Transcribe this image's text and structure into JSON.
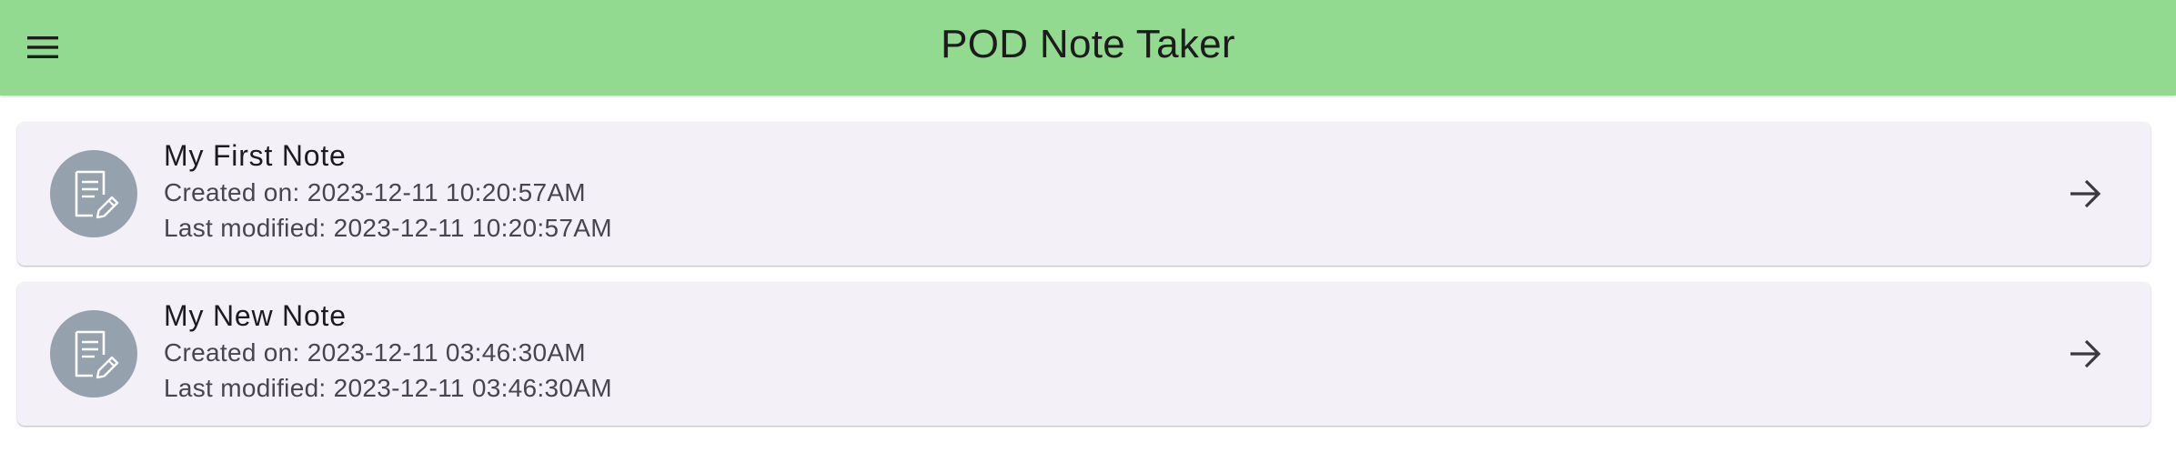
{
  "appbar": {
    "title": "POD Note Taker",
    "menu_icon": "hamburger-menu-icon",
    "background_color": "#91da8f"
  },
  "notes": [
    {
      "title": "My First Note",
      "created": "Created on: 2023-12-11 10:20:57AM",
      "modified": "Last modified: 2023-12-11 10:20:57AM",
      "icon": "note-edit-icon",
      "action_icon": "arrow-forward-icon"
    },
    {
      "title": "My New Note",
      "created": "Created on: 2023-12-11 03:46:30AM",
      "modified": "Last modified: 2023-12-11 03:46:30AM",
      "icon": "note-edit-icon",
      "action_icon": "arrow-forward-icon"
    }
  ],
  "colors": {
    "card_background": "#f3f0f7",
    "avatar_background": "#95a2ad"
  }
}
